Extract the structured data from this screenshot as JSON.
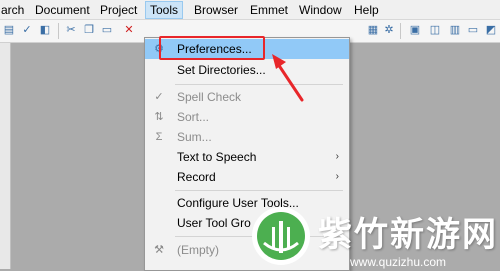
{
  "menubar": {
    "items": [
      "arch",
      "Document",
      "Project",
      "Tools",
      "Browser",
      "Emmet",
      "Window",
      "Help"
    ]
  },
  "tools_menu": {
    "items": [
      {
        "label": "Preferences...",
        "icon": "gear-icon",
        "enabled": true,
        "highlighted": true,
        "submenu": false
      },
      {
        "label": "Set Directories...",
        "icon": "",
        "enabled": true,
        "submenu": false
      },
      {
        "label": "Spell Check",
        "icon": "spellcheck-icon",
        "enabled": false,
        "submenu": false
      },
      {
        "label": "Sort...",
        "icon": "sort-icon",
        "enabled": false,
        "submenu": false
      },
      {
        "label": "Sum...",
        "icon": "sigma-icon",
        "enabled": false,
        "submenu": false
      },
      {
        "label": "Text to Speech",
        "icon": "",
        "enabled": true,
        "submenu": true
      },
      {
        "label": "Record",
        "icon": "",
        "enabled": true,
        "submenu": true
      },
      {
        "label": "Configure User Tools...",
        "icon": "",
        "enabled": true,
        "submenu": false
      },
      {
        "label": "User Tool Gro",
        "icon": "",
        "enabled": true,
        "submenu": false
      },
      {
        "label": "(Empty)",
        "icon": "tools-icon",
        "enabled": false,
        "submenu": false
      }
    ],
    "submenu_arrow": "›"
  },
  "watermark": {
    "text": "紫竹新游网",
    "url": "www.quzizhu.com"
  },
  "colors": {
    "highlight_box": "#e8262a",
    "menu_highlight": "#91c9f7"
  }
}
